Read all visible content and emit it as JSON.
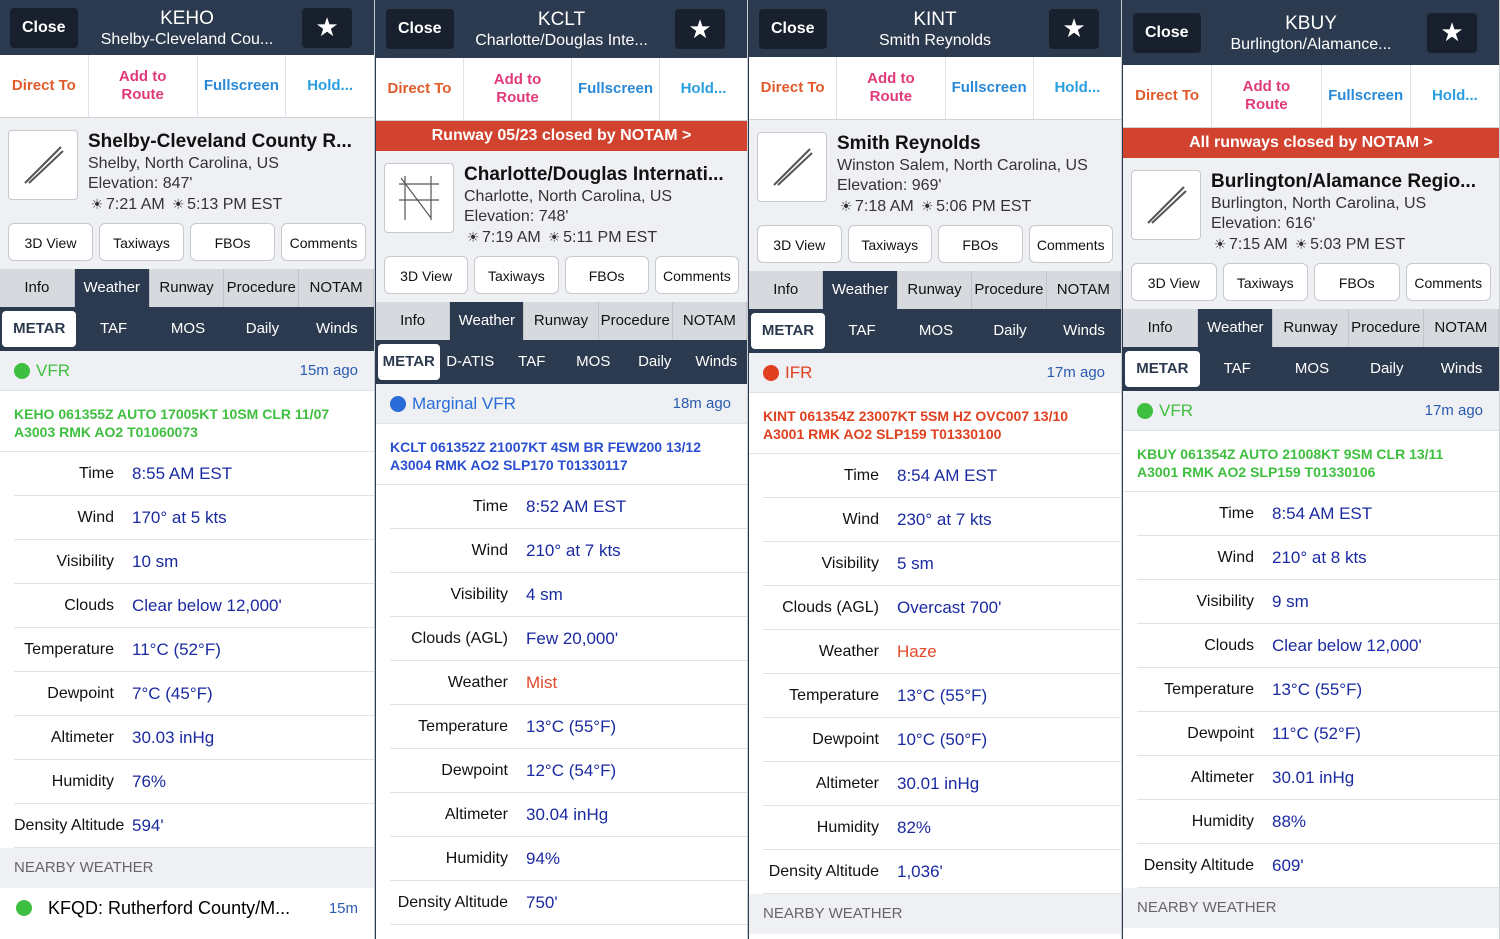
{
  "colors": {
    "vfr": "#3fbf3f",
    "marginal_vfr": "#2a6bd8",
    "ifr": "#e0401f"
  },
  "panels": [
    {
      "ident": "KEHO",
      "title_name": "Shelby-Cleveland Cou...",
      "close": "Close",
      "actions": [
        "Direct To",
        "Add to Route",
        "Fullscreen",
        "Hold..."
      ],
      "notam": "",
      "name": "Shelby-Cleveland County R...",
      "location": "Shelby, North Carolina, US",
      "elevation": "Elevation: 847'",
      "sunrise": "7:21 AM",
      "sunset": "5:13 PM EST",
      "buttons": [
        "3D View",
        "Taxiways",
        "FBOs",
        "Comments"
      ],
      "tabs": [
        "Info",
        "Weather",
        "Runway",
        "Procedure",
        "NOTAM"
      ],
      "subtabs": [
        "METAR",
        "TAF",
        "MOS",
        "Daily",
        "Winds"
      ],
      "category": "VFR",
      "category_color": "#3fbf3f",
      "age": "15m ago",
      "raw": "KEHO 061355Z AUTO 17005KT 10SM CLR 11/07 A3003 RMK AO2 T01060073",
      "raw_color": "#3fbf3f",
      "rows": [
        {
          "label": "Time",
          "value": "8:55 AM EST"
        },
        {
          "label": "Wind",
          "value": "170° at 5 kts"
        },
        {
          "label": "Visibility",
          "value": "10 sm"
        },
        {
          "label": "Clouds",
          "value": "Clear below 12,000'"
        },
        {
          "label": "Temperature",
          "value": "11°C (52°F)"
        },
        {
          "label": "Dewpoint",
          "value": "7°C (45°F)"
        },
        {
          "label": "Altimeter",
          "value": "30.03 inHg"
        },
        {
          "label": "Humidity",
          "value": "76%"
        },
        {
          "label": "Density Altitude",
          "value": "594'"
        }
      ],
      "nearby_head": "NEARBY WEATHER",
      "nearby": {
        "name": "KFQD: Rutherford County/M...",
        "age": "15m"
      }
    },
    {
      "ident": "KCLT",
      "title_name": "Charlotte/Douglas Inte...",
      "close": "Close",
      "actions": [
        "Direct To",
        "Add to Route",
        "Fullscreen",
        "Hold..."
      ],
      "notam": "Runway 05/23 closed by NOTAM >",
      "name": "Charlotte/Douglas Internati...",
      "location": "Charlotte, North Carolina, US",
      "elevation": "Elevation: 748'",
      "sunrise": "7:19 AM",
      "sunset": "5:11 PM EST",
      "buttons": [
        "3D View",
        "Taxiways",
        "FBOs",
        "Comments"
      ],
      "tabs": [
        "Info",
        "Weather",
        "Runway",
        "Procedure",
        "NOTAM"
      ],
      "subtabs": [
        "METAR",
        "D-ATIS",
        "TAF",
        "MOS",
        "Daily",
        "Winds"
      ],
      "category": "Marginal VFR",
      "category_color": "#2a6bd8",
      "age": "18m ago",
      "raw": "KCLT 061352Z 21007KT 4SM BR FEW200 13/12 A3004 RMK AO2 SLP170 T01330117",
      "raw_color": "#2a4fd0",
      "rows": [
        {
          "label": "Time",
          "value": "8:52 AM EST"
        },
        {
          "label": "Wind",
          "value": "210° at 7 kts"
        },
        {
          "label": "Visibility",
          "value": "4 sm"
        },
        {
          "label": "Clouds (AGL)",
          "value": "Few 20,000'"
        },
        {
          "label": "Weather",
          "value": "Mist",
          "red": true
        },
        {
          "label": "Temperature",
          "value": "13°C (55°F)"
        },
        {
          "label": "Dewpoint",
          "value": "12°C (54°F)"
        },
        {
          "label": "Altimeter",
          "value": "30.04 inHg"
        },
        {
          "label": "Humidity",
          "value": "94%"
        },
        {
          "label": "Density Altitude",
          "value": "750'"
        }
      ]
    },
    {
      "ident": "KINT",
      "title_name": "Smith Reynolds",
      "close": "Close",
      "actions": [
        "Direct To",
        "Add to Route",
        "Fullscreen",
        "Hold..."
      ],
      "notam": "",
      "name": "Smith Reynolds",
      "location": "Winston Salem, North Carolina, US",
      "elevation": "Elevation: 969'",
      "sunrise": "7:18 AM",
      "sunset": "5:06 PM EST",
      "buttons": [
        "3D View",
        "Taxiways",
        "FBOs",
        "Comments"
      ],
      "tabs": [
        "Info",
        "Weather",
        "Runway",
        "Procedure",
        "NOTAM"
      ],
      "subtabs": [
        "METAR",
        "TAF",
        "MOS",
        "Daily",
        "Winds"
      ],
      "category": "IFR",
      "category_color": "#e0401f",
      "age": "17m ago",
      "raw": "KINT 061354Z 23007KT 5SM HZ OVC007 13/10 A3001 RMK AO2 SLP159 T01330100",
      "raw_color": "#e0401f",
      "rows": [
        {
          "label": "Time",
          "value": "8:54 AM EST"
        },
        {
          "label": "Wind",
          "value": "230° at 7 kts"
        },
        {
          "label": "Visibility",
          "value": "5 sm"
        },
        {
          "label": "Clouds (AGL)",
          "value": "Overcast 700'"
        },
        {
          "label": "Weather",
          "value": "Haze",
          "red": true
        },
        {
          "label": "Temperature",
          "value": "13°C (55°F)"
        },
        {
          "label": "Dewpoint",
          "value": "10°C (50°F)"
        },
        {
          "label": "Altimeter",
          "value": "30.01 inHg"
        },
        {
          "label": "Humidity",
          "value": "82%"
        },
        {
          "label": "Density Altitude",
          "value": "1,036'"
        }
      ],
      "nearby_head": "NEARBY WEATHER"
    },
    {
      "ident": "KBUY",
      "title_name": "Burlington/Alamance...",
      "close": "Close",
      "actions": [
        "Direct To",
        "Add to Route",
        "Fullscreen",
        "Hold..."
      ],
      "notam": "All runways closed by NOTAM >",
      "name": "Burlington/Alamance Regio...",
      "location": "Burlington, North Carolina, US",
      "elevation": "Elevation: 616'",
      "sunrise": "7:15 AM",
      "sunset": "5:03 PM EST",
      "buttons": [
        "3D View",
        "Taxiways",
        "FBOs",
        "Comments"
      ],
      "tabs": [
        "Info",
        "Weather",
        "Runway",
        "Procedure",
        "NOTAM"
      ],
      "subtabs": [
        "METAR",
        "TAF",
        "MOS",
        "Daily",
        "Winds"
      ],
      "category": "VFR",
      "category_color": "#3fbf3f",
      "age": "17m ago",
      "raw": "KBUY 061354Z AUTO 21008KT 9SM CLR 13/11 A3001 RMK AO2 SLP159 T01330106",
      "raw_color": "#3fbf3f",
      "rows": [
        {
          "label": "Time",
          "value": "8:54 AM EST"
        },
        {
          "label": "Wind",
          "value": "210° at 8 kts"
        },
        {
          "label": "Visibility",
          "value": "9 sm"
        },
        {
          "label": "Clouds",
          "value": "Clear below 12,000'"
        },
        {
          "label": "Temperature",
          "value": "13°C (55°F)"
        },
        {
          "label": "Dewpoint",
          "value": "11°C (52°F)"
        },
        {
          "label": "Altimeter",
          "value": "30.01 inHg"
        },
        {
          "label": "Humidity",
          "value": "88%"
        },
        {
          "label": "Density Altitude",
          "value": "609'"
        }
      ],
      "nearby_head": "NEARBY WEATHER"
    }
  ]
}
